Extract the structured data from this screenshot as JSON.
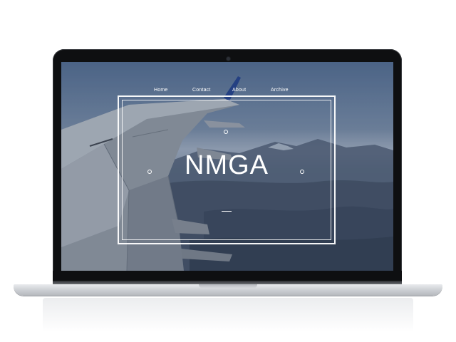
{
  "site": {
    "logo_text": "NMGA"
  },
  "nav": {
    "items": [
      {
        "label": "Home"
      },
      {
        "label": "Contact"
      },
      {
        "label": "About"
      },
      {
        "label": "Archive"
      }
    ]
  },
  "colors": {
    "screen_tint": "#6a7d95",
    "frame_white": "#ffffff",
    "bezel": "#0e0f11",
    "aluminum": "#cfd2d6"
  },
  "icons": {
    "camera": "webcam-icon"
  }
}
